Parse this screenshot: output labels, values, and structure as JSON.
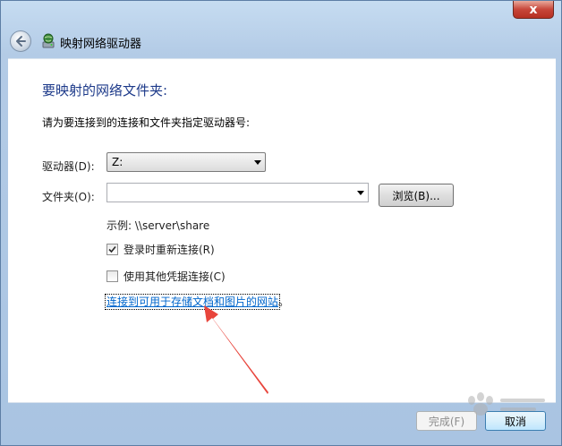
{
  "window": {
    "title": "映射网络驱动器",
    "close_glyph": "x"
  },
  "content": {
    "heading": "要映射的网络文件夹:",
    "instruction": "请为要连接到的连接和文件夹指定驱动器号:",
    "drive": {
      "label": "驱动器(D):",
      "value": "Z:"
    },
    "folder": {
      "label": "文件夹(O):",
      "value": "",
      "browse_label": "浏览(B)..."
    },
    "example": "示例: \\\\server\\share",
    "reconnect": {
      "label": "登录时重新连接(R)",
      "checked": true
    },
    "other_credentials": {
      "label": "使用其他凭据连接(C)",
      "checked": false
    },
    "link": {
      "text": "连接到可用于存储文档和图片的网站",
      "suffix": "。"
    }
  },
  "footer": {
    "finish_label": "完成(F)",
    "cancel_label": "取消"
  },
  "colors": {
    "heading": "#1d3a8a",
    "link": "#0066cc",
    "annotation_arrow": "#e8453c"
  },
  "icons": {
    "back": "back-arrow-icon",
    "title": "network-drive-icon",
    "close": "close-icon",
    "annotation": "red-arrow-icon"
  }
}
